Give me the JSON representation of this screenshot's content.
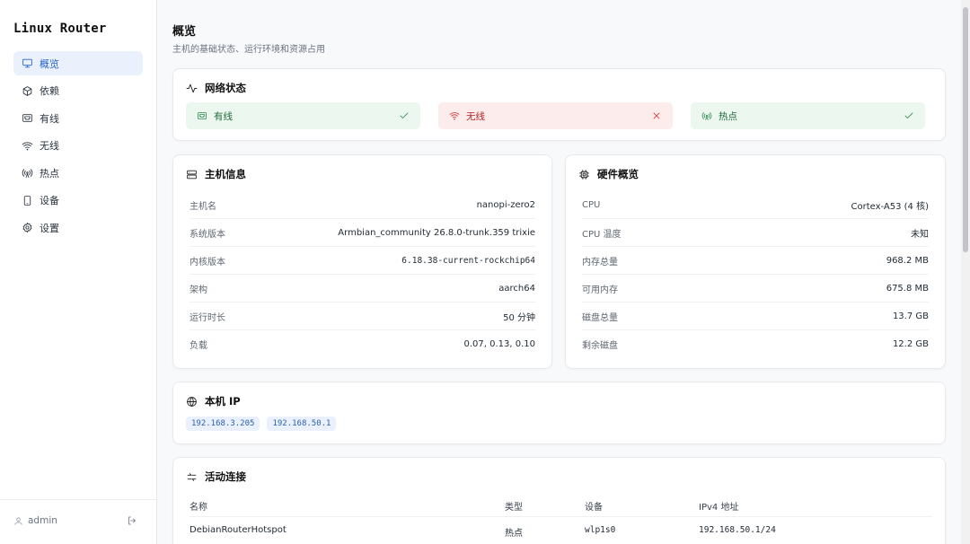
{
  "app": {
    "brand": "Linux Router",
    "user": "admin"
  },
  "sidebar": {
    "items": [
      {
        "label": "概览",
        "icon": "monitor-icon",
        "active": true
      },
      {
        "label": "依赖",
        "icon": "package-icon",
        "active": false
      },
      {
        "label": "有线",
        "icon": "ethernet-icon",
        "active": false
      },
      {
        "label": "无线",
        "icon": "wifi-icon",
        "active": false
      },
      {
        "label": "热点",
        "icon": "antenna-icon",
        "active": false
      },
      {
        "label": "设备",
        "icon": "tablet-icon",
        "active": false
      },
      {
        "label": "设置",
        "icon": "gear-icon",
        "active": false
      }
    ]
  },
  "page": {
    "title": "概览",
    "subtitle": "主机的基础状态、运行环境和资源占用"
  },
  "network": {
    "title": "网络状态",
    "items": [
      {
        "label": "有线",
        "state": "ok",
        "icon": "ethernet-icon",
        "status_icon": "check-icon"
      },
      {
        "label": "无线",
        "state": "error",
        "icon": "wifi-icon",
        "status_icon": "x-icon"
      },
      {
        "label": "热点",
        "state": "ok",
        "icon": "antenna-icon",
        "status_icon": "check-icon"
      }
    ]
  },
  "host": {
    "title": "主机信息",
    "rows": [
      {
        "key": "主机名",
        "value": "nanopi-zero2"
      },
      {
        "key": "系统版本",
        "value": "Armbian_community 26.8.0-trunk.359 trixie"
      },
      {
        "key": "内核版本",
        "value": "6.18.38-current-rockchip64"
      },
      {
        "key": "架构",
        "value": "aarch64"
      },
      {
        "key": "运行时长",
        "value": "50 分钟"
      },
      {
        "key": "负载",
        "value": "0.07, 0.13, 0.10"
      }
    ]
  },
  "hardware": {
    "title": "硬件概览",
    "rows": [
      {
        "key": "CPU",
        "value": "Cortex-A53 (4 核)"
      },
      {
        "key": "CPU 温度",
        "value": "未知"
      },
      {
        "key": "内存总量",
        "value": "968.2 MB"
      },
      {
        "key": "可用内存",
        "value": "675.8 MB"
      },
      {
        "key": "磁盘总量",
        "value": "13.7 GB"
      },
      {
        "key": "剩余磁盘",
        "value": "12.2 GB"
      }
    ]
  },
  "ip": {
    "title": "本机 IP",
    "addresses": [
      "192.168.3.205",
      "192.168.50.1"
    ]
  },
  "connections": {
    "title": "活动连接",
    "headers": [
      "名称",
      "类型",
      "设备",
      "IPv4 地址"
    ],
    "rows": [
      [
        "DebianRouterHotspot",
        "热点",
        "wlp1s0",
        "192.168.50.1/24"
      ]
    ]
  },
  "colors": {
    "accent": "#2563c9",
    "ok_bg": "#ebf7ef",
    "error_bg": "#fdecec"
  }
}
